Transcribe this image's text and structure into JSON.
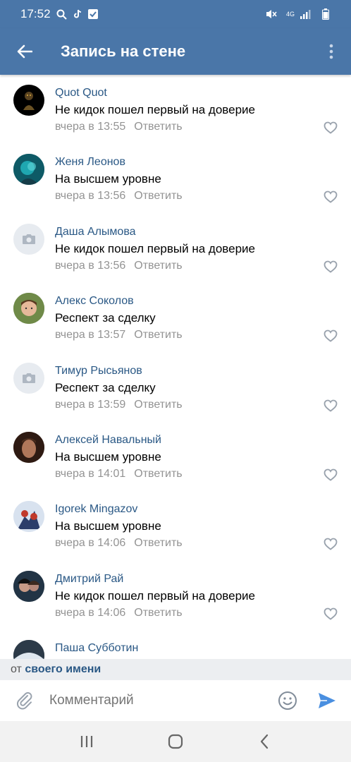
{
  "status_bar": {
    "time": "17:52",
    "network": "4G",
    "icons": [
      "search-icon",
      "tiktok-icon",
      "checkbox-icon",
      "mute-icon",
      "signal-icon",
      "battery-icon"
    ]
  },
  "app_bar": {
    "title": "Запись на стене",
    "back_icon": "arrow-left-icon",
    "menu_icon": "more-vertical-icon"
  },
  "colors": {
    "header_bg": "#4a76a8",
    "author_link": "#2a5885",
    "meta_gray": "#939393",
    "send_blue": "#4a8fe0"
  },
  "comments": [
    {
      "author": "Quot Quot",
      "text": "Не кидок пошел первый на доверие",
      "time": "вчера в 13:55",
      "reply": "Ответить",
      "avatar": "photo"
    },
    {
      "author": "Женя Леонов",
      "text": "На высшем уровне",
      "time": "вчера в 13:56",
      "reply": "Ответить",
      "avatar": "photo"
    },
    {
      "author": "Даша Алымова",
      "text": "Не кидок пошел первый на доверие",
      "time": "вчера в 13:56",
      "reply": "Ответить",
      "avatar": "camera-placeholder"
    },
    {
      "author": "Алекс Соколов",
      "text": "Респект за сделку",
      "time": "вчера в 13:57",
      "reply": "Ответить",
      "avatar": "photo"
    },
    {
      "author": "Тимур Рысьянов",
      "text": "Респект за сделку",
      "time": "вчера в 13:59",
      "reply": "Ответить",
      "avatar": "camera-placeholder"
    },
    {
      "author": "Алексей Навальный",
      "text": "На высшем уровне",
      "time": "вчера в 14:01",
      "reply": "Ответить",
      "avatar": "photo"
    },
    {
      "author": "Igorek Mingazov",
      "text": "На высшем уровне",
      "time": "вчера в 14:06",
      "reply": "Ответить",
      "avatar": "photo"
    },
    {
      "author": "Дмитрий Рай",
      "text": "Не кидок пошел первый на доверие",
      "time": "вчера в 14:06",
      "reply": "Ответить",
      "avatar": "photo"
    },
    {
      "author": "Паша Субботин",
      "text": "",
      "time": "",
      "reply": "",
      "avatar": "photo"
    }
  ],
  "from_bar": {
    "prefix": "от",
    "link": "своего имени"
  },
  "composer": {
    "placeholder": "Комментарий"
  }
}
